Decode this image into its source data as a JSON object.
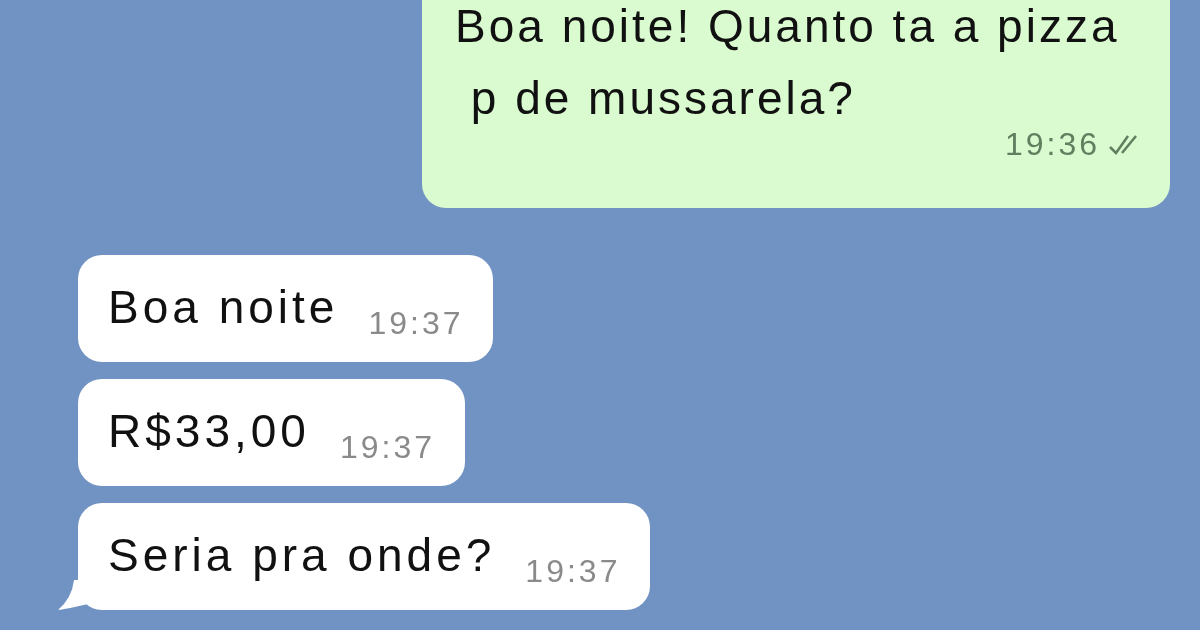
{
  "messages": [
    {
      "kind": "outgoing",
      "text": "Boa noite! Quanto ta a pizza\n p de mussarela?",
      "time": "19:36",
      "read": true,
      "tail": false
    },
    {
      "kind": "incoming",
      "text": "Boa noite",
      "time": "19:37",
      "tail": false
    },
    {
      "kind": "incoming",
      "text": "R$33,00",
      "time": "19:37",
      "tail": false
    },
    {
      "kind": "incoming",
      "text": "Seria pra onde?",
      "time": "19:37",
      "tail": true
    }
  ]
}
